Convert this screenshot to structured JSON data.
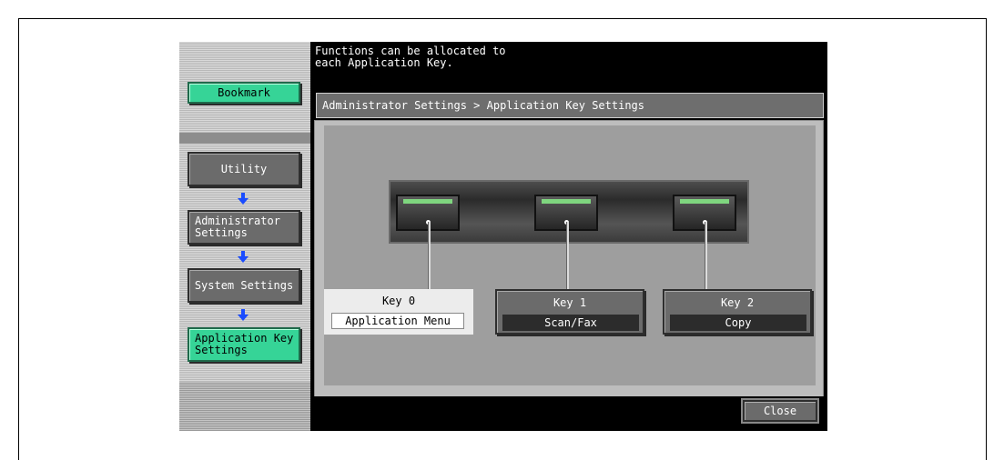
{
  "sidebar": {
    "bookmark_label": "Bookmark",
    "items": [
      {
        "label": "Utility"
      },
      {
        "label": "Administrator Settings"
      },
      {
        "label": "System Settings"
      },
      {
        "label": "Application Key Settings"
      }
    ]
  },
  "message": {
    "line1": "Functions can be allocated to",
    "line2": "each Application Key."
  },
  "breadcrumb": "Administrator Settings > Application Key Settings",
  "keys": [
    {
      "name": "Key 0",
      "value": "Application Menu"
    },
    {
      "name": "Key 1",
      "value": "Scan/Fax"
    },
    {
      "name": "Key 2",
      "value": "Copy"
    }
  ],
  "close_label": "Close",
  "colors": {
    "accent_green": "#36d497",
    "button_gray": "#6b6b6b",
    "led_green": "#7fd67f"
  },
  "icons": {
    "nav_arrow": "arrow-down-icon"
  }
}
